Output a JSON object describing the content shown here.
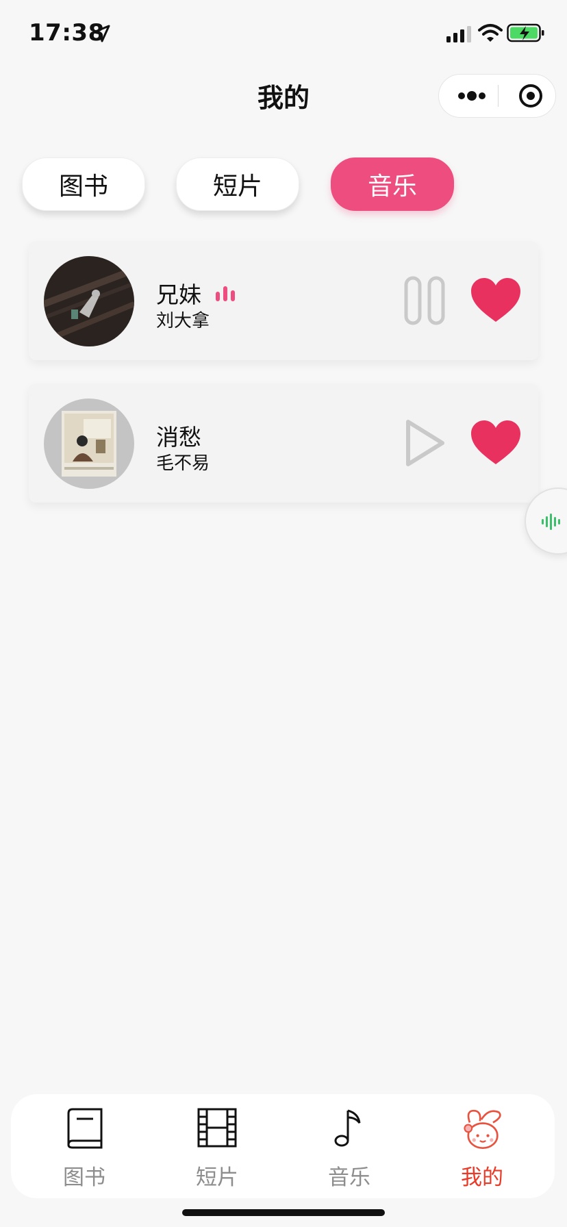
{
  "status_bar": {
    "time": "17:38"
  },
  "header": {
    "title": "我的"
  },
  "tabs": [
    {
      "label": "图书",
      "active": false
    },
    {
      "label": "短片",
      "active": false
    },
    {
      "label": "音乐",
      "active": true
    }
  ],
  "songs": [
    {
      "title": "兄妹",
      "artist": "刘大拿",
      "playing": true,
      "control": "pause-icon",
      "liked": true
    },
    {
      "title": "消愁",
      "artist": "毛不易",
      "playing": false,
      "control": "play-icon",
      "liked": true
    }
  ],
  "bottom_nav": [
    {
      "label": "图书",
      "icon": "book-icon",
      "active": false
    },
    {
      "label": "短片",
      "icon": "film-icon",
      "active": false
    },
    {
      "label": "音乐",
      "icon": "music-note-icon",
      "active": false
    },
    {
      "label": "我的",
      "icon": "rabbit-avatar-icon",
      "active": true
    }
  ],
  "colors": {
    "accent": "#ee4d7f",
    "heart": "#e8315e",
    "active_nav": "#e83a27",
    "float_wave": "#3cbf6a"
  }
}
